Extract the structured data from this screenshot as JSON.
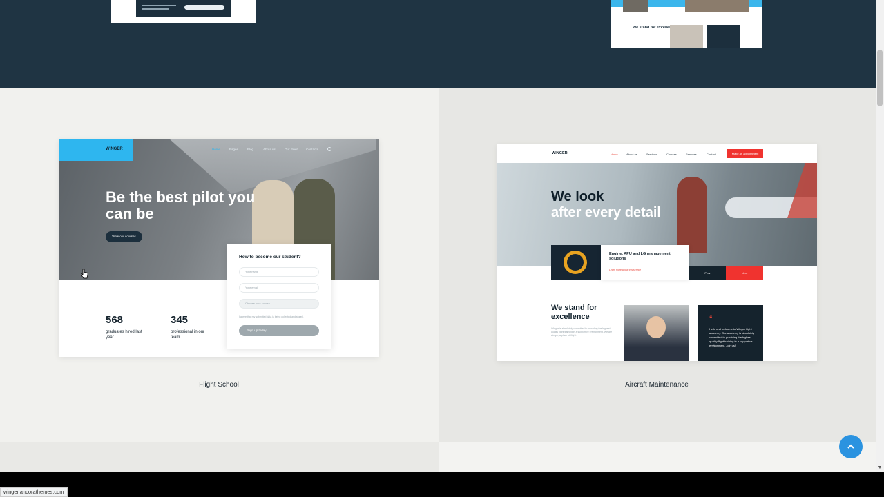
{
  "status_url": "winger.ancorathemes.com",
  "cards": [
    {
      "caption": "Flight School",
      "preview": {
        "logo": "WINGER",
        "nav": [
          "Home",
          "Pages",
          "Blog",
          "About us",
          "Our Fleet",
          "Contacts"
        ],
        "hero_title": "Be the best pilot you can be",
        "hero_button": "View our courses",
        "stats": [
          {
            "value": "568",
            "label": "graduates hired last year"
          },
          {
            "value": "345",
            "label": "professional in our team"
          }
        ],
        "form": {
          "title": "How to become our student?",
          "fields": [
            "Your name",
            "Your email",
            "Choose your course"
          ],
          "checkbox": "I agree that my submitted data is being collected and stored.",
          "submit": "Sign up today"
        }
      }
    },
    {
      "caption": "Aircraft Maintenance",
      "preview": {
        "logo": "WINGER",
        "nav": [
          "Home",
          "About us",
          "Services",
          "Courses",
          "Features",
          "Contact"
        ],
        "nav_button": "Make an appointment",
        "hero_title_line1": "We look",
        "hero_title_line2": "after every detail",
        "service_title": "Engine, APU and LG management solutions",
        "service_link": "Learn more about this service",
        "prev": "Prev",
        "next": "Next",
        "section_title": "We stand for excellence",
        "section_text": "Winger is absolutely committed to providing the highest quality flight training in a supportive environment. We are winger, a place of flight.",
        "quote_mark": "“",
        "quote_text": "Hello and welcome to Winger flight academy. Our academy is absolutely committed to providing the highest quality flight training in a supportive environment. Join us!"
      }
    }
  ],
  "top_previews": {
    "right_text": "We stand for excellence"
  },
  "colors": {
    "dark_band": "#1f3443",
    "accent_blue": "#2eb6ef",
    "accent_red": "#f0332f",
    "scroll_to_top": "#2b93e0"
  }
}
